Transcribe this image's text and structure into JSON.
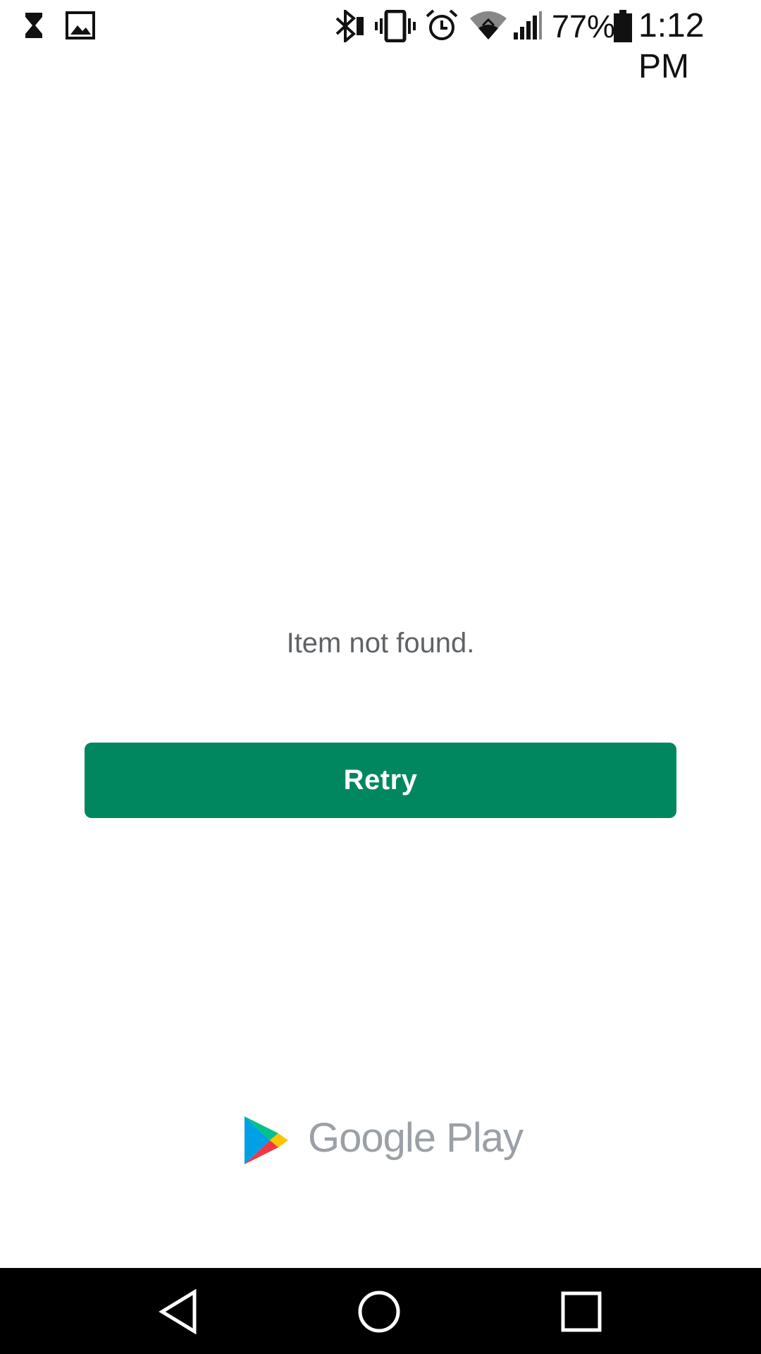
{
  "status_bar": {
    "notification_icons": [
      "hourglass-icon",
      "image-icon"
    ],
    "system_icons": [
      "bluetooth-icon",
      "vibrate-icon",
      "alarm-icon",
      "wifi-icon",
      "signal-icon",
      "battery-icon"
    ],
    "battery_percent": "77%",
    "time": "1:12 PM"
  },
  "content": {
    "message": "Item not found.",
    "retry_label": "Retry"
  },
  "branding": {
    "logo_text": "Google Play",
    "logo_icon": "google-play-icon"
  },
  "nav_bar": {
    "buttons": [
      "back-icon",
      "home-icon",
      "recents-icon"
    ]
  },
  "colors": {
    "accent": "#01875f",
    "message_text": "#5f6368",
    "brand_text": "#9aa0a6",
    "nav_bar": "#000000",
    "background": "#ffffff"
  }
}
